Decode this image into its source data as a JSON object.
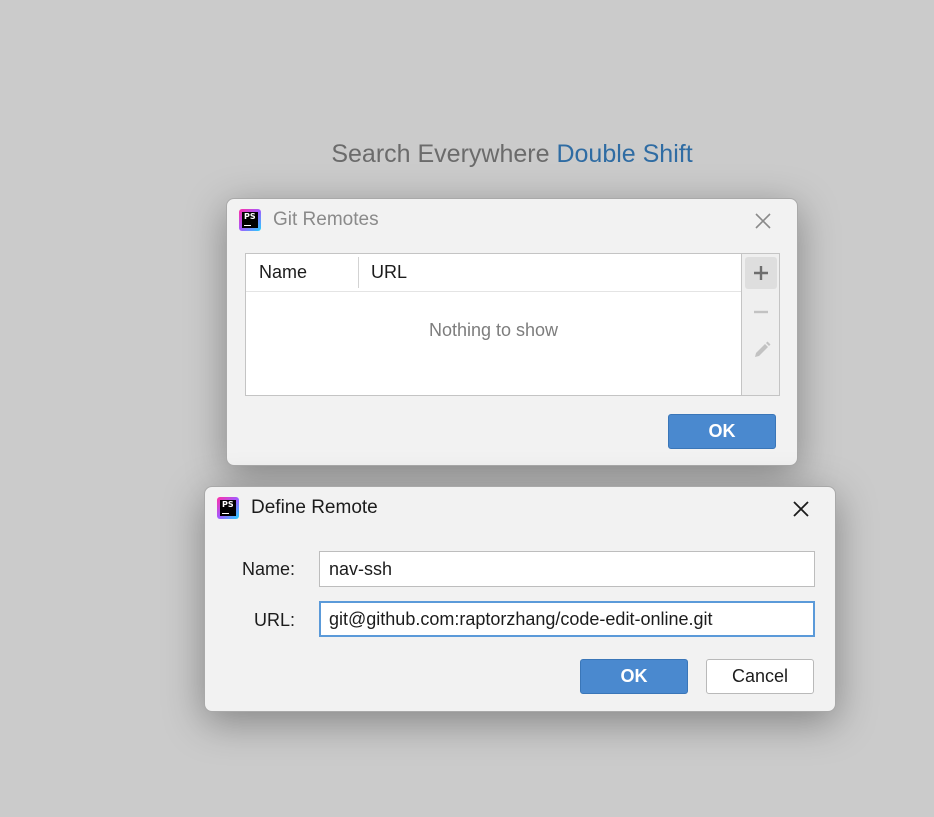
{
  "background": {
    "search_hint_prefix": "Search Everywhere",
    "search_hint_shortcut": "Double Shift"
  },
  "git_remotes_dialog": {
    "title": "Git Remotes",
    "icon": "phpstorm-app-icon",
    "icon_text": "PS",
    "columns": [
      "Name",
      "URL"
    ],
    "empty_text": "Nothing to show",
    "toolbar": [
      "add-icon",
      "remove-icon",
      "edit-icon"
    ],
    "ok_label": "OK"
  },
  "define_remote_dialog": {
    "title": "Define Remote",
    "icon": "phpstorm-app-icon",
    "icon_text": "PS",
    "name_label": "Name:",
    "name_value": "nav-ssh",
    "url_label": "URL:",
    "url_value": "git@github.com:raptorzhang/code-edit-online.git",
    "ok_label": "OK",
    "cancel_label": "Cancel"
  },
  "colors": {
    "background": "#cbcbcb",
    "dialog": "#f2f2f2",
    "accent": "#4a89cf",
    "shortcut": "#2f6ca3",
    "focus_border": "#5b9ad9"
  }
}
